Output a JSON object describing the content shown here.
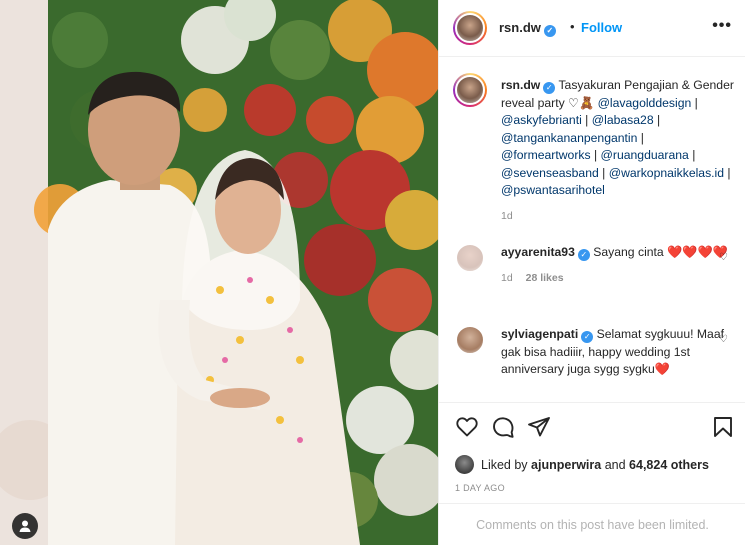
{
  "post": {
    "author": "rsn.dw",
    "separator": "•",
    "follow_label": "Follow",
    "more_label": "•••"
  },
  "caption": {
    "username": "rsn.dw",
    "text_line": "Tasyakuran Pengajian & Gender reveal party ♡🧸",
    "mentions": [
      "@lavagolddesign",
      "@askyfebrianti",
      "@labasa28",
      "@tangankananpengantin",
      "@formeartworks",
      "@ruangduarana",
      "@sevenseasband",
      "@warkopnaikkelas.id",
      "@pswantasarihotel"
    ],
    "mention_separator": "|",
    "time": "1d"
  },
  "comments": [
    {
      "username": "ayyarenita93",
      "text": "Sayang cinta",
      "hearts": "❤️❤️❤️❤️",
      "time": "1d",
      "likes": "28 likes"
    },
    {
      "username": "sylviagenpati",
      "text": "Selamat sygkuuu! Maaf gak bisa hadiiir, happy wedding 1st anniversary juga sygg sygku",
      "hearts": "❤️"
    }
  ],
  "footer": {
    "liked_by_prefix": "Liked by",
    "liked_by_user": "ajunperwira",
    "liked_by_and": "and",
    "liked_by_count": "64,824 others",
    "time_ago": "1 DAY AGO",
    "comments_limited": "Comments on this post have been limited."
  },
  "colors": {
    "link_blue": "#0095f6",
    "mention_blue": "#00376b",
    "verified_blue": "#3897f0",
    "heart_red": "#ed4956",
    "muted_gray": "#8e8e8e"
  },
  "icons": {
    "like": "heart-outline-icon",
    "comment": "comment-bubble-icon",
    "share": "paper-plane-icon",
    "save": "bookmark-icon",
    "tagged_user": "user-silhouette-icon",
    "verified": "verified-badge-icon"
  }
}
